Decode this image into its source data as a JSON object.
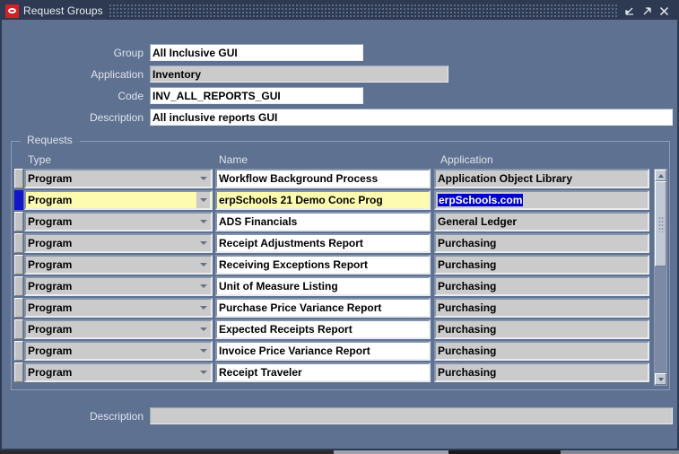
{
  "window": {
    "title": "Request Groups",
    "logo_icon": "oracle-logo-icon",
    "buttons": [
      {
        "name": "restore-button",
        "glyph": "restore-icon"
      },
      {
        "name": "maximize-button",
        "glyph": "maximize-icon"
      },
      {
        "name": "close-button",
        "glyph": "close-icon"
      }
    ]
  },
  "header_form": {
    "group_label": "Group",
    "group_value": "All Inclusive GUI",
    "application_label": "Application",
    "application_value": "Inventory",
    "code_label": "Code",
    "code_value": "INV_ALL_REPORTS_GUI",
    "description_label": "Description",
    "description_value": "All inclusive reports GUI"
  },
  "requests": {
    "group_title": "Requests",
    "columns": {
      "type": "Type",
      "name": "Name",
      "application": "Application"
    },
    "rows": [
      {
        "type": "Program",
        "name": "Workflow Background Process",
        "application": "Application Object Library",
        "current": false,
        "highlight": false,
        "app_selected": false
      },
      {
        "type": "Program",
        "name": "erpSchools 21 Demo Conc Prog",
        "application": "erpSchools.com",
        "current": true,
        "highlight": true,
        "app_selected": true
      },
      {
        "type": "Program",
        "name": "ADS Financials",
        "application": "General Ledger",
        "current": false,
        "highlight": false,
        "app_selected": false
      },
      {
        "type": "Program",
        "name": "Receipt Adjustments Report",
        "application": "Purchasing",
        "current": false,
        "highlight": false,
        "app_selected": false
      },
      {
        "type": "Program",
        "name": "Receiving Exceptions Report",
        "application": "Purchasing",
        "current": false,
        "highlight": false,
        "app_selected": false
      },
      {
        "type": "Program",
        "name": "Unit of Measure Listing",
        "application": "Purchasing",
        "current": false,
        "highlight": false,
        "app_selected": false
      },
      {
        "type": "Program",
        "name": "Purchase Price Variance Report",
        "application": "Purchasing",
        "current": false,
        "highlight": false,
        "app_selected": false
      },
      {
        "type": "Program",
        "name": "Expected Receipts Report",
        "application": "Purchasing",
        "current": false,
        "highlight": false,
        "app_selected": false
      },
      {
        "type": "Program",
        "name": "Invoice Price Variance Report",
        "application": "Purchasing",
        "current": false,
        "highlight": false,
        "app_selected": false
      },
      {
        "type": "Program",
        "name": "Receipt Traveler",
        "application": "Purchasing",
        "current": false,
        "highlight": false,
        "app_selected": false
      }
    ],
    "scrollbar": {
      "up_icon": "scroll-up-icon",
      "down_icon": "scroll-down-icon"
    }
  },
  "footer": {
    "description_label": "Description",
    "description_value": ""
  },
  "colors": {
    "window_background": "#5f7191",
    "titlebar": "#2e3a52",
    "field_readonly": "#cbcbcb",
    "field_editable": "#ffffff",
    "row_highlight": "#fdfbb0",
    "selection_blue": "#0000c8",
    "current_record_marker": "#1414c8",
    "oracle_red": "#d42027"
  }
}
